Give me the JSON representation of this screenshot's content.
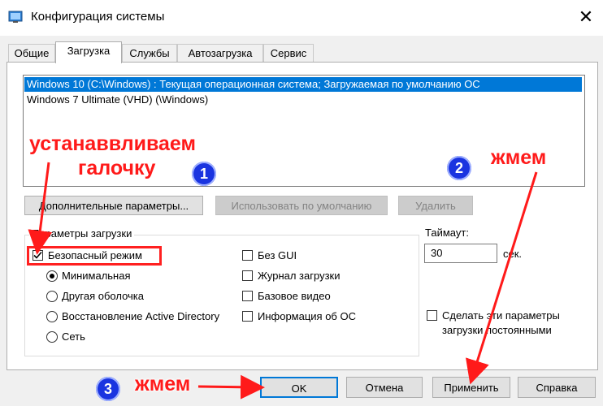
{
  "window": {
    "title": "Конфигурация системы",
    "close_glyph": "✕"
  },
  "tabs": [
    {
      "label": "Общие"
    },
    {
      "label": "Загрузка"
    },
    {
      "label": "Службы"
    },
    {
      "label": "Автозагрузка"
    },
    {
      "label": "Сервис"
    }
  ],
  "active_tab": "Загрузка",
  "os_list": [
    {
      "label": "Windows 10 (C:\\Windows) : Текущая операционная система; Загружаемая по умолчанию ОС",
      "selected": true
    },
    {
      "label": "Windows 7 Ultimate (VHD) (\\Windows)",
      "selected": false
    }
  ],
  "os_buttons": {
    "advanced": "Дополнительные параметры...",
    "set_default": "Использовать по умолчанию",
    "delete": "Удалить"
  },
  "boot_options": {
    "legend": "Параметры загрузки",
    "safe_boot": {
      "label": "Безопасный режим",
      "checked": true
    },
    "radios": [
      {
        "label": "Минимальная",
        "selected": true
      },
      {
        "label": "Другая оболочка",
        "selected": false
      },
      {
        "label": "Восстановление Active Directory",
        "selected": false
      },
      {
        "label": "Сеть",
        "selected": false
      }
    ],
    "checks": [
      {
        "label": "Без GUI",
        "checked": false
      },
      {
        "label": "Журнал загрузки",
        "checked": false
      },
      {
        "label": "Базовое видео",
        "checked": false
      },
      {
        "label": "Информация  об ОС",
        "checked": false
      }
    ]
  },
  "timeout": {
    "label": "Таймаут:",
    "value": "30",
    "unit": "сек."
  },
  "permanent": {
    "line1": "Сделать эти параметры",
    "line2": "загрузки постоянными",
    "checked": false
  },
  "footer_buttons": {
    "ok": "OK",
    "cancel": "Отмена",
    "apply": "Применить",
    "help": "Справка"
  },
  "annotations": {
    "set_line1": "устанаввливаем",
    "set_line2": "галочку",
    "press_top": "жмем",
    "press_bottom": "жмем",
    "badge1": "1",
    "badge2": "2",
    "badge3": "3",
    "color": "#ff1a1a",
    "badge_color": "#1a34e0"
  }
}
